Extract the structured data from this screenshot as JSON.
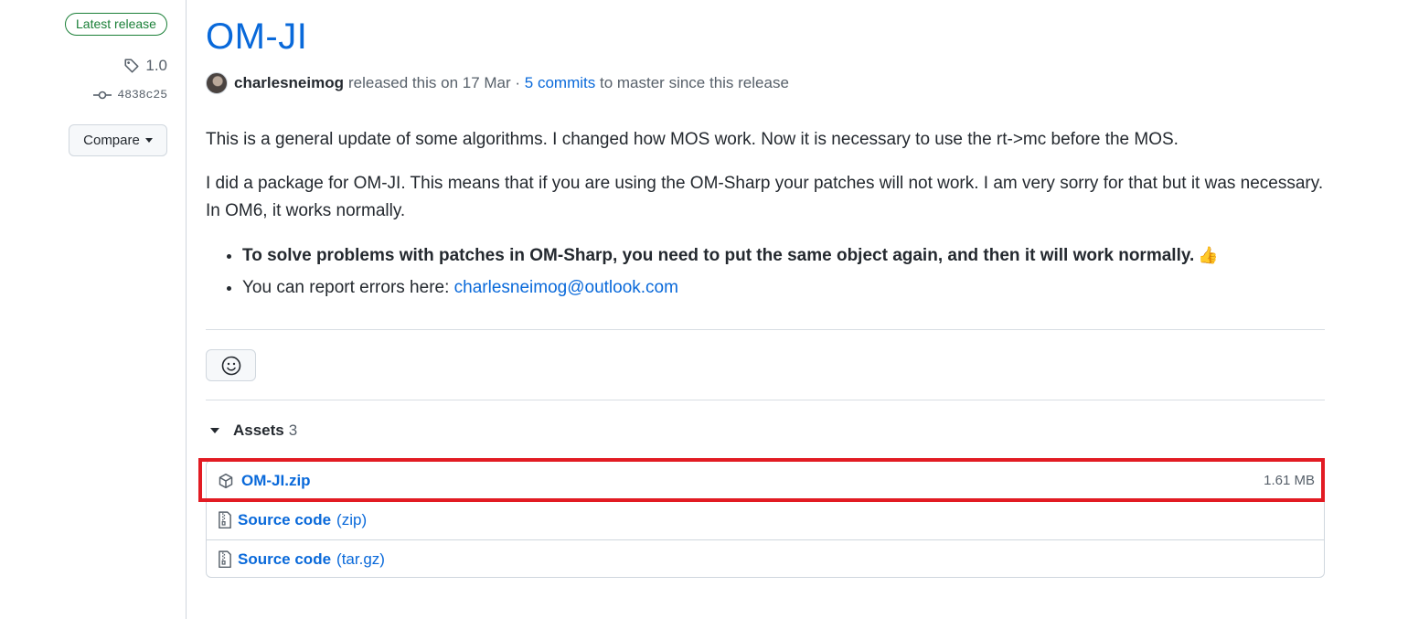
{
  "sidebar": {
    "badge": "Latest release",
    "tag": "1.0",
    "commit": "4838c25",
    "compare_label": "Compare"
  },
  "release": {
    "title": "OM-JI",
    "author": "charlesneimog",
    "released_text": "released this on 17 Mar ·",
    "commits_link": "5 commits",
    "since_text": "to master since this release",
    "para1": "This is a general update of some algorithms. I changed how MOS work. Now it is necessary to use the rt->mc before the MOS.",
    "para2": "I did a package for OM-JI. This means that if you are using the OM-Sharp your patches will not work. I am very sorry for that but it was necessary. In OM6, it works normally.",
    "bullet1": "To solve problems with patches in OM-Sharp, you need to put the same object again, and then it will work normally.",
    "bullet1_emoji": "👍",
    "bullet2_prefix": "You can report errors here:",
    "bullet2_link": "charlesneimog@outlook.com"
  },
  "assets": {
    "label": "Assets",
    "count": "3",
    "items": [
      {
        "name": "OM-JI.zip",
        "ext": "",
        "size": "1.61 MB",
        "icon": "package-icon"
      },
      {
        "name": "Source code",
        "ext": "(zip)",
        "size": "",
        "icon": "file-zip-icon"
      },
      {
        "name": "Source code",
        "ext": "(tar.gz)",
        "size": "",
        "icon": "file-zip-icon"
      }
    ]
  },
  "colors": {
    "link": "#0969da",
    "badge_green": "#1a7f37",
    "highlight_red": "#e21b23"
  }
}
